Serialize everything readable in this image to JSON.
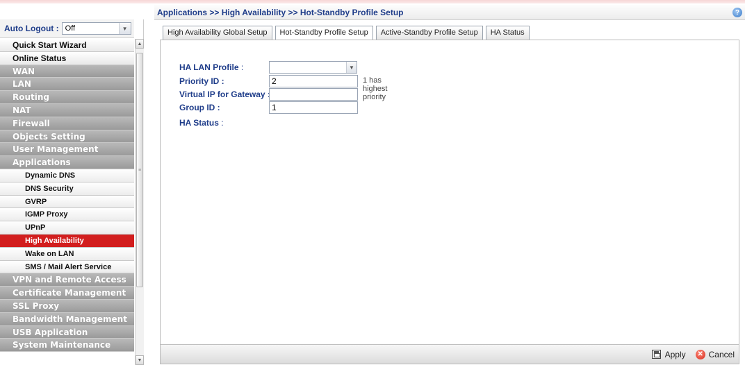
{
  "sidebar": {
    "auto_logout_label": "Auto Logout :",
    "auto_logout_value": "Off",
    "items": [
      {
        "label": "Quick Start Wizard",
        "kind": "plain"
      },
      {
        "label": "Online Status",
        "kind": "plain"
      },
      {
        "label": "WAN",
        "kind": "grp"
      },
      {
        "label": "LAN",
        "kind": "grp"
      },
      {
        "label": "Routing",
        "kind": "grp"
      },
      {
        "label": "NAT",
        "kind": "grp"
      },
      {
        "label": "Firewall",
        "kind": "grp"
      },
      {
        "label": "Objects Setting",
        "kind": "grp"
      },
      {
        "label": "User Management",
        "kind": "grp"
      },
      {
        "label": "Applications",
        "kind": "grp"
      },
      {
        "label": "Dynamic DNS",
        "kind": "sub"
      },
      {
        "label": "DNS Security",
        "kind": "sub"
      },
      {
        "label": "GVRP",
        "kind": "sub"
      },
      {
        "label": "IGMP Proxy",
        "kind": "sub"
      },
      {
        "label": "UPnP",
        "kind": "sub"
      },
      {
        "label": "High Availability",
        "kind": "sub",
        "active": true
      },
      {
        "label": "Wake on LAN",
        "kind": "sub"
      },
      {
        "label": "SMS / Mail Alert Service",
        "kind": "sub"
      },
      {
        "label": "VPN and Remote Access",
        "kind": "grp"
      },
      {
        "label": "Certificate Management",
        "kind": "grp"
      },
      {
        "label": "SSL Proxy",
        "kind": "grp"
      },
      {
        "label": "Bandwidth Management",
        "kind": "grp"
      },
      {
        "label": "USB Application",
        "kind": "grp"
      },
      {
        "label": "System Maintenance",
        "kind": "grp"
      }
    ]
  },
  "header": {
    "breadcrumb": "Applications >> High Availability >> Hot-Standby Profile Setup",
    "help_icon": "?"
  },
  "tabs": [
    {
      "label": "High Availability Global Setup"
    },
    {
      "label": "Hot-Standby Profile Setup",
      "active": true
    },
    {
      "label": "Active-Standby Profile Setup"
    },
    {
      "label": "HA Status"
    }
  ],
  "form": {
    "ha_lan_profile_label": "HA LAN Profile",
    "ha_lan_profile_value": "",
    "priority_id_label": "Priority ID :",
    "priority_id_value": "2",
    "priority_hint": "1 has highest priority",
    "virtual_ip_label": "Virtual IP for Gateway :",
    "virtual_ip_value": "",
    "group_id_label": "Group ID :",
    "group_id_value": "1",
    "ha_status_label": "HA Status",
    "colon": ":"
  },
  "footer": {
    "apply_label": "Apply",
    "cancel_label": "Cancel"
  },
  "colors": {
    "accent_text": "#1f3d8a",
    "active_menu": "#d21e1e",
    "group_menu": "#a8a8a8"
  }
}
